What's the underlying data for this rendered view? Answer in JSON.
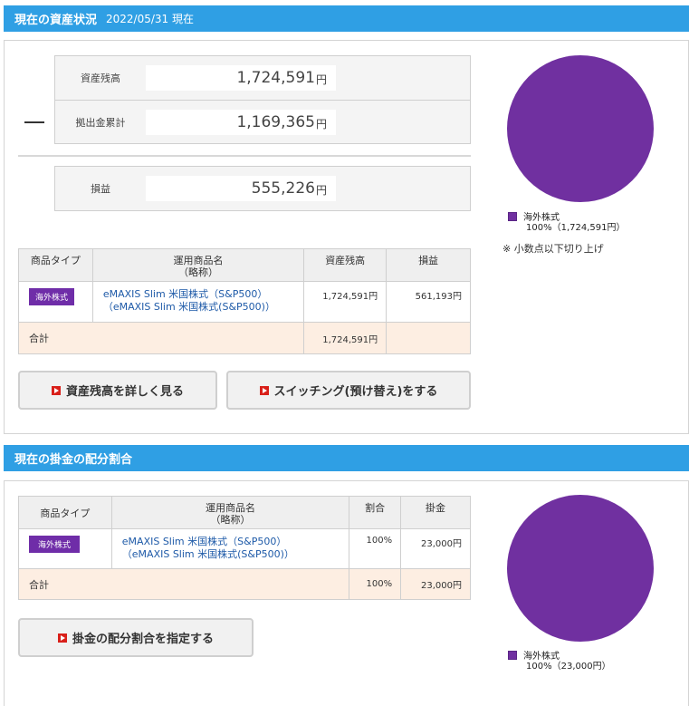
{
  "assets": {
    "header_title": "現在の資産状況",
    "header_date": "2022/05/31 現在",
    "summary": [
      {
        "label": "資産残高",
        "value": "1,724,591",
        "unit": "円"
      },
      {
        "label": "拠出金累計",
        "value": "1,169,365",
        "unit": "円"
      },
      {
        "label": "損益",
        "value": "555,226",
        "unit": "円"
      }
    ],
    "table": {
      "headers": [
        "商品タイプ",
        "運用商品名\n（略称）",
        "資産残高",
        "損益"
      ],
      "rows": [
        {
          "type": "海外株式",
          "name": "eMAXIS Slim 米国株式（S&P500）",
          "short": "（eMAXIS Slim 米国株式(S&P500)）",
          "balance": "1,724,591円",
          "pl": "561,193円"
        }
      ],
      "total_label": "合計",
      "total_balance": "1,724,591円",
      "total_pl": ""
    },
    "buttons": {
      "detail": "資産残高を詳しく見る",
      "switching": "スイッチング(預け替え)をする"
    },
    "pie": {
      "legend_name": "海外株式",
      "legend_value": "100%（1,724,591円）",
      "note": "※ 小数点以下切り上げ"
    }
  },
  "allocation": {
    "header_title": "現在の掛金の配分割合",
    "table": {
      "headers": [
        "商品タイプ",
        "運用商品名\n（略称）",
        "割合",
        "掛金"
      ],
      "rows": [
        {
          "type": "海外株式",
          "name": "eMAXIS Slim 米国株式（S&P500）",
          "short": "（eMAXIS Slim 米国株式(S&P500)）",
          "ratio": "100%",
          "amount": "23,000円"
        }
      ],
      "total_label": "合計",
      "total_ratio": "100%",
      "total_amount": "23,000円"
    },
    "buttons": {
      "specify": "掛金の配分割合を指定する"
    },
    "pie": {
      "legend_name": "海外株式",
      "legend_value": "100%（23,000円）"
    }
  },
  "colors": {
    "header": "#2f9fe4",
    "foreign_stock": "#7030a0",
    "total_row": "#fdeee2",
    "link": "#1e5aa8",
    "button_icon": "#d9201a"
  },
  "chart_data": [
    {
      "type": "pie",
      "categories": [
        "海外株式"
      ],
      "values": [
        100
      ]
    },
    {
      "type": "pie",
      "categories": [
        "海外株式"
      ],
      "values": [
        100
      ]
    }
  ]
}
